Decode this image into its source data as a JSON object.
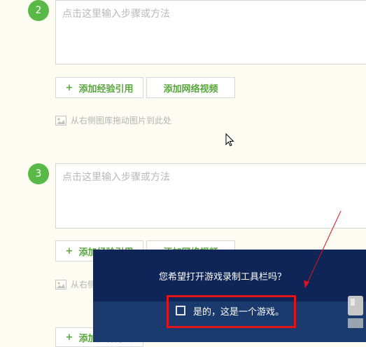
{
  "steps": [
    {
      "num": "2",
      "placeholder": "点击这里输入步骤或方法",
      "btn_ref": "添加经验引用",
      "btn_video": "添加网络视频",
      "hint": "从右侧图库拖动图片到此处"
    },
    {
      "num": "3",
      "placeholder": "点击这里输入步骤或方法",
      "btn_ref": "添加经验引用",
      "btn_video": "添加网络视频",
      "hint": "从右侧图库拖动图片到此处"
    }
  ],
  "plus": "+",
  "add_method_label": "添加步骤方法",
  "dialog": {
    "question": "您希望打开游戏录制工具栏吗？",
    "checkbox_label": "是的，这是一个游戏。"
  },
  "colors": {
    "accent_green": "#58b946",
    "dialog_bg": "#0f2557",
    "highlight_red": "#e0141a"
  },
  "icons": [
    "image-icon",
    "mouse-cursor-icon",
    "checkbox-icon",
    "red-arrow"
  ]
}
